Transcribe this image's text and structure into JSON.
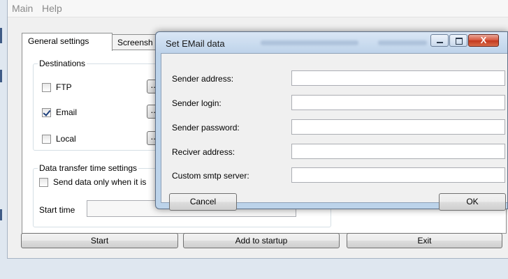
{
  "menubar": {
    "items": [
      "Main",
      "Help"
    ]
  },
  "tabs": [
    {
      "label": "General settings",
      "active": true
    },
    {
      "label": "Screensh"
    }
  ],
  "destinations": {
    "legend": "Destinations",
    "items": [
      {
        "label": "FTP",
        "checked": false,
        "button": "..."
      },
      {
        "label": "Email",
        "checked": true,
        "button": "..."
      },
      {
        "label": "Local",
        "checked": false,
        "button": "..."
      }
    ]
  },
  "transfer": {
    "legend": "Data transfer time settings",
    "only_when_label": "Send data only when it is",
    "start_time_label": "Start time"
  },
  "bottom_buttons": {
    "start": "Start",
    "add_to_startup": "Add to startup",
    "exit": "Exit"
  },
  "dialog": {
    "title": "Set EMail data",
    "fields": [
      {
        "label": "Sender address:",
        "value": ""
      },
      {
        "label": "Sender login:",
        "value": ""
      },
      {
        "label": "Sender password:",
        "value": ""
      },
      {
        "label": "Reciver address:",
        "value": ""
      },
      {
        "label": "Custom smtp server:",
        "value": ""
      }
    ],
    "cancel": "Cancel",
    "ok": "OK",
    "close_glyph": "X"
  },
  "colors": {
    "titlebar": "#bed3ea",
    "close": "#c3371d",
    "check": "#1d3f7b"
  }
}
